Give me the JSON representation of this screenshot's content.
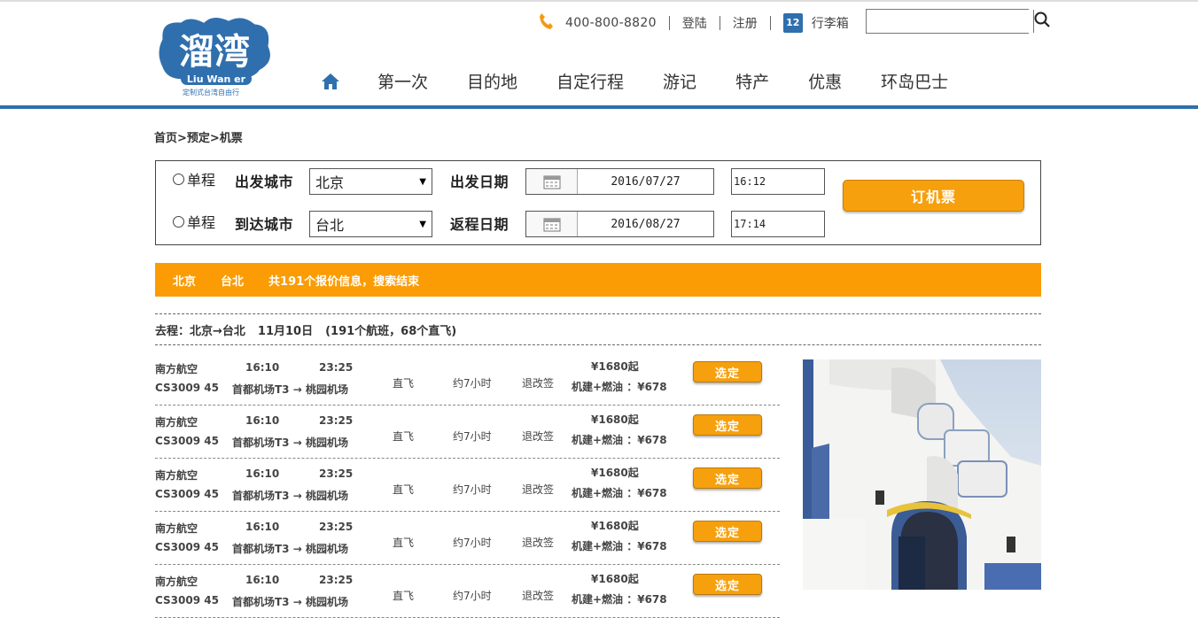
{
  "brand": {
    "logo_text": "溜湾",
    "logo_sub_en": "Liu Wan er",
    "logo_tagline": "定制式台湾自由行"
  },
  "header": {
    "phone": "400-800-8820",
    "login": "登陆",
    "register": "注册",
    "luggage_badge": "12",
    "luggage": "行李箱",
    "search_placeholder": ""
  },
  "nav": {
    "items": [
      {
        "label": "第一次"
      },
      {
        "label": "目的地"
      },
      {
        "label": "自定行程"
      },
      {
        "label": "游记"
      },
      {
        "label": "特产"
      },
      {
        "label": "优惠"
      },
      {
        "label": "环岛巴士"
      }
    ]
  },
  "breadcrumb": "首页>预定>机票",
  "search_form": {
    "row1": {
      "radio": "单程",
      "city_label": "出发城市",
      "city": "北京",
      "date_label": "出发日期",
      "date": "2016/07/27",
      "time": "16:12"
    },
    "row2": {
      "radio": "单程",
      "city_label": "到达城市",
      "city": "台北",
      "date_label": "返程日期",
      "date": "2016/08/27",
      "time": "17:14"
    },
    "book_button": "订机票"
  },
  "result_bar": {
    "from": "北京",
    "to": "台北",
    "summary": "共191个报价信息，搜索结束"
  },
  "route": {
    "label": "去程：北京→台北",
    "date": "11月10日",
    "stats": "(191个航班，68个直飞)"
  },
  "flights": [
    {
      "airline": "南方航空",
      "flight_no": "CS3009 45",
      "dep_time": "16:10",
      "arr_time": "23:25",
      "airports": "首都机场T3 → 桃园机场",
      "direct": "直飞",
      "duration": "约7小时",
      "change": "退改签",
      "price": "¥1680起",
      "tax": "机建+燃油 ：¥678",
      "select": "选定"
    },
    {
      "airline": "南方航空",
      "flight_no": "CS3009 45",
      "dep_time": "16:10",
      "arr_time": "23:25",
      "airports": "首都机场T3 → 桃园机场",
      "direct": "直飞",
      "duration": "约7小时",
      "change": "退改签",
      "price": "¥1680起",
      "tax": "机建+燃油 ：¥678",
      "select": "选定"
    },
    {
      "airline": "南方航空",
      "flight_no": "CS3009 45",
      "dep_time": "16:10",
      "arr_time": "23:25",
      "airports": "首都机场T3 → 桃园机场",
      "direct": "直飞",
      "duration": "约7小时",
      "change": "退改签",
      "price": "¥1680起",
      "tax": "机建+燃油 ：¥678",
      "select": "选定"
    },
    {
      "airline": "南方航空",
      "flight_no": "CS3009 45",
      "dep_time": "16:10",
      "arr_time": "23:25",
      "airports": "首都机场T3 → 桃园机场",
      "direct": "直飞",
      "duration": "约7小时",
      "change": "退改签",
      "price": "¥1680起",
      "tax": "机建+燃油 ：¥678",
      "select": "选定"
    },
    {
      "airline": "南方航空",
      "flight_no": "CS3009 45",
      "dep_time": "16:10",
      "arr_time": "23:25",
      "airports": "首都机场T3 → 桃园机场",
      "direct": "直飞",
      "duration": "约7小时",
      "change": "退改签",
      "price": "¥1680起",
      "tax": "机建+燃油 ：¥678",
      "select": "选定"
    }
  ],
  "colors": {
    "accent_orange": "#fb9c05",
    "brand_blue": "#2f6fae"
  },
  "icons": {
    "phone": "phone-icon",
    "search": "search-icon",
    "home": "home-icon",
    "calendar": "calendar-icon"
  }
}
